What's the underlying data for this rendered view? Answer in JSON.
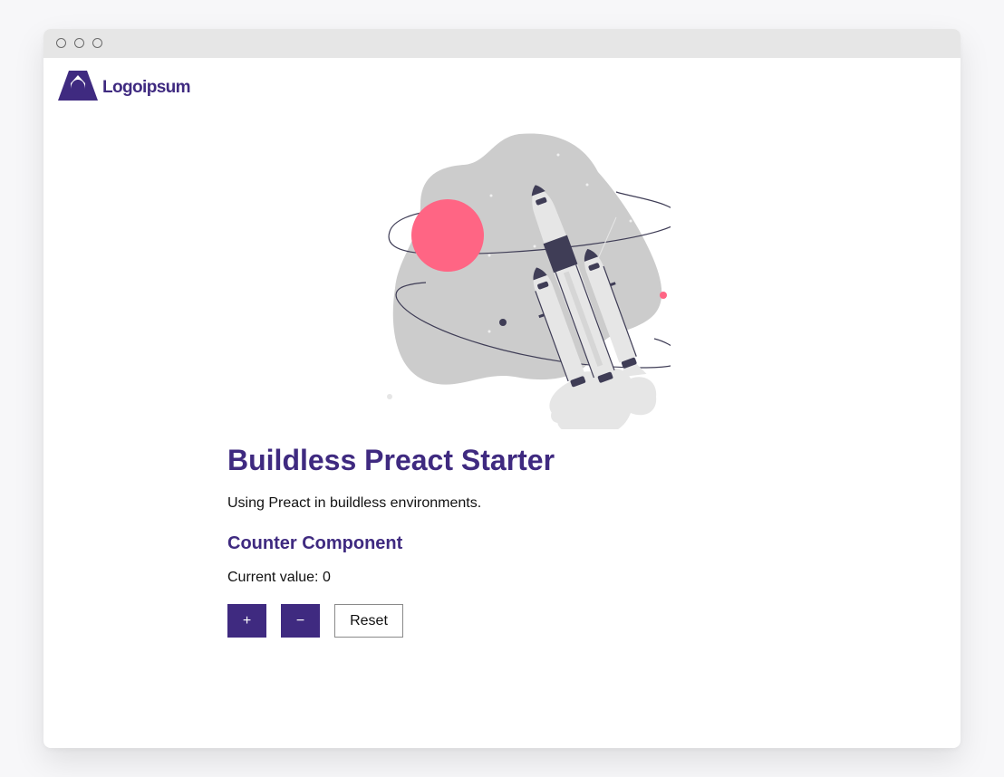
{
  "window": {
    "controls": [
      "window-close",
      "window-minimize",
      "window-maximize"
    ]
  },
  "brand": {
    "name": "Logoipsum",
    "logo_icon": "logoipsum-logo-icon",
    "color": "#3f2a80"
  },
  "hero": {
    "illustration": "rocket-launch-illustration",
    "accent_color": "#ff6584",
    "blob_color": "#cccccc",
    "dark_color": "#3f3d56"
  },
  "page": {
    "title": "Buildless Preact Starter",
    "subtitle": "Using Preact in buildless environments."
  },
  "counter": {
    "heading": "Counter Component",
    "label": "Current value:",
    "value": 0,
    "increment_label": "+",
    "decrement_label": "−",
    "reset_label": "Reset"
  }
}
